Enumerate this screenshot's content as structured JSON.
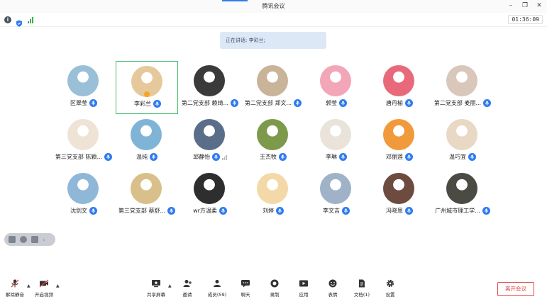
{
  "window": {
    "title": "腾讯会议"
  },
  "infobar": {
    "timer": "01:36:09"
  },
  "speaking": {
    "text": "正在讲话: 李彩兰;"
  },
  "participants": [
    {
      "name": "区翠莹",
      "avatar_color": "#9ac0d8",
      "avatar_icon": "photo-avatar-icon"
    },
    {
      "name": "李彩兰",
      "avatar_color": "#e6c99b",
      "avatar_icon": "photo-avatar-icon",
      "active": true
    },
    {
      "name": "第二党支部 赖绮...",
      "avatar_color": "#3a3a3a",
      "avatar_icon": "photo-avatar-icon"
    },
    {
      "name": "第二党支部 郑文...",
      "avatar_color": "#c9b49a",
      "avatar_icon": "photo-avatar-icon"
    },
    {
      "name": "郭莹",
      "avatar_color": "#f2a6b8",
      "avatar_icon": "photo-avatar-icon"
    },
    {
      "name": "唐丹榆",
      "avatar_color": "#e86a7a",
      "avatar_icon": "photo-avatar-icon"
    },
    {
      "name": "第二党支部 麦丽...",
      "avatar_color": "#d9c7bb",
      "avatar_icon": "photo-avatar-icon"
    },
    {
      "name": "第三党支部 陈颖...",
      "avatar_color": "#efe3d6",
      "avatar_icon": "photo-avatar-icon"
    },
    {
      "name": "温纯",
      "avatar_color": "#7fb4d6",
      "avatar_icon": "photo-avatar-icon"
    },
    {
      "name": "邱静怡",
      "avatar_color": "#5a6e8a",
      "avatar_icon": "photo-avatar-icon",
      "muted_bars": true
    },
    {
      "name": "王杰牧",
      "avatar_color": "#7c9a4a",
      "avatar_icon": "photo-avatar-icon"
    },
    {
      "name": "李琳",
      "avatar_color": "#e9e3da",
      "avatar_icon": "photo-avatar-icon"
    },
    {
      "name": "邓丽莲",
      "avatar_color": "#f19a3c",
      "avatar_icon": "photo-avatar-icon"
    },
    {
      "name": "温巧宜",
      "avatar_color": "#e8d8c4",
      "avatar_icon": "photo-avatar-icon"
    },
    {
      "name": "沈剑文",
      "avatar_color": "#8fb7d8",
      "avatar_icon": "photo-avatar-icon"
    },
    {
      "name": "第三党支部 蔡舒...",
      "avatar_color": "#d9c08a",
      "avatar_icon": "photo-avatar-icon"
    },
    {
      "name": "wr方温柔",
      "avatar_color": "#2e2e2e",
      "avatar_icon": "photo-avatar-icon"
    },
    {
      "name": "刘婷",
      "avatar_color": "#f3d9a8",
      "avatar_icon": "photo-avatar-icon"
    },
    {
      "name": "李文吉",
      "avatar_color": "#9fb2c8",
      "avatar_icon": "photo-avatar-icon"
    },
    {
      "name": "冯晓恩",
      "avatar_color": "#6d4b3f",
      "avatar_icon": "photo-avatar-icon"
    },
    {
      "name": "广州城市理工学...",
      "avatar_color": "#4b4b44",
      "avatar_icon": "photo-avatar-icon"
    }
  ],
  "toolbar": {
    "mute": "解除静音",
    "video": "开启视频",
    "share": "共享屏幕",
    "invite": "邀请",
    "members": "成员(59)",
    "chat": "聊天",
    "record": "录制",
    "apps": "应用",
    "emoji": "表情",
    "docs": "文档(1)",
    "settings": "设置",
    "leave": "离开会议"
  },
  "colors": {
    "accent": "#2f7bf0",
    "active_border": "#3dbf6a",
    "leave": "#e04848"
  }
}
